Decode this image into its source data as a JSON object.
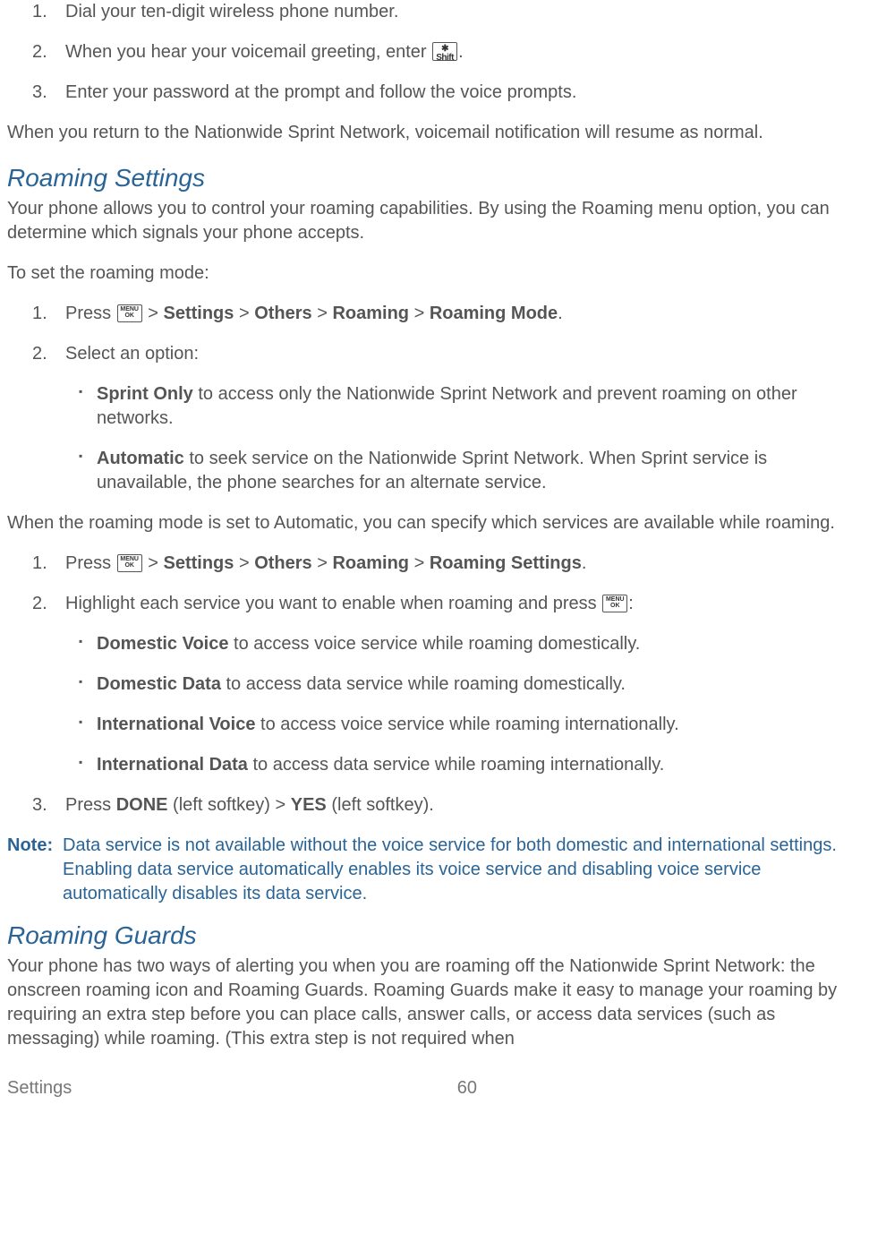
{
  "icons": {
    "menu_ok_top": "MENU",
    "menu_ok_bottom": "OK",
    "star_key": "✱ Shift"
  },
  "top_list": {
    "items": [
      {
        "num": "1.",
        "text": "Dial your ten-digit wireless phone number."
      },
      {
        "num": "2.",
        "pre": "When you hear your voicemail greeting, enter ",
        "post": "."
      },
      {
        "num": "3.",
        "text": "Enter your password at the prompt and follow the voice prompts."
      }
    ]
  },
  "para_return": "When you return to the Nationwide Sprint Network, voicemail notification will resume as normal.",
  "roaming_settings": {
    "heading": "Roaming Settings",
    "intro": "Your phone allows you to control your roaming capabilities. By using the Roaming menu option, you can determine which signals your phone accepts.",
    "set_mode": "To set the roaming mode:",
    "step1": {
      "num": "1.",
      "pre": "Press ",
      "path": [
        " > ",
        "Settings",
        " > ",
        "Others",
        " > ",
        "Roaming",
        " > ",
        "Roaming Mode",
        "."
      ]
    },
    "step2": {
      "num": "2.",
      "text": "Select an option:"
    },
    "options": [
      {
        "bold": "Sprint Only",
        "rest": " to access only the Nationwide Sprint Network and prevent roaming on other networks."
      },
      {
        "bold": "Automatic",
        "rest": " to seek service on the Nationwide Sprint Network. When Sprint service is unavailable, the phone searches for an alternate service."
      }
    ],
    "auto_para": "When the roaming mode is set to Automatic, you can specify which services are available while roaming.",
    "step1b": {
      "num": "1.",
      "pre": "Press ",
      "path": [
        " > ",
        "Settings",
        " > ",
        "Others",
        " > ",
        "Roaming",
        " > ",
        "Roaming Settings",
        "."
      ]
    },
    "step2b": {
      "num": "2.",
      "pre": "Highlight each service you want to enable when roaming and press ",
      "post": ":"
    },
    "services": [
      {
        "bold": "Domestic Voice",
        "rest": " to access voice service while roaming domestically."
      },
      {
        "bold": "Domestic Data",
        "rest": " to access data service while roaming domestically."
      },
      {
        "bold": "International Voice",
        "rest": " to access voice service while roaming internationally."
      },
      {
        "bold": "International Data",
        "rest": " to access data service while roaming internationally."
      }
    ],
    "step3b": {
      "num": "3.",
      "pre": "Press ",
      "b1": "DONE",
      "mid1": " (left softkey) > ",
      "b2": "YES",
      "mid2": " (left softkey)."
    }
  },
  "note": {
    "label": "Note:",
    "body": "Data service is not available without the voice service for both domestic and international settings. Enabling data service automatically enables its voice service and disabling voice service automatically disables its data service."
  },
  "roaming_guards": {
    "heading": "Roaming Guards",
    "intro": "Your phone has two ways of alerting you when you are roaming off the Nationwide Sprint Network: the onscreen roaming icon and Roaming Guards. Roaming Guards make it easy to manage your roaming by requiring an extra step before you can place calls, answer calls, or access data services (such as messaging) while roaming. (This extra step is not required when"
  },
  "footer": {
    "section": "Settings",
    "page": "60"
  }
}
